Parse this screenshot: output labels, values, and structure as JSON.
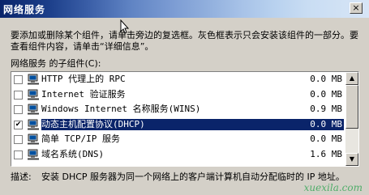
{
  "window": {
    "title": "网络服务",
    "close_glyph": "×"
  },
  "description": "要添加或删除某个组件，请单击旁边的复选框。灰色框表示只会安装该组件的一部分。要查看组件内容，请单击“详细信息”。",
  "subcomponents_label": "网络服务 的子组件(C):",
  "components": [
    {
      "name": "HTTP 代理上的 RPC",
      "size": "0.0 MB",
      "checked": false,
      "selected": false,
      "icon": "network-computer-icon"
    },
    {
      "name": "Internet 验证服务",
      "size": "0.0 MB",
      "checked": false,
      "selected": false,
      "icon": "network-computer-icon"
    },
    {
      "name": "Windows Internet 名称服务(WINS)",
      "size": "0.9 MB",
      "checked": false,
      "selected": false,
      "icon": "network-computer-icon"
    },
    {
      "name": "动态主机配置协议(DHCP)",
      "size": "0.0 MB",
      "checked": true,
      "selected": true,
      "icon": "network-computer-icon"
    },
    {
      "name": "简单 TCP/IP 服务",
      "size": "0.0 MB",
      "checked": false,
      "selected": false,
      "icon": "network-computer-icon"
    },
    {
      "name": "域名系统(DNS)",
      "size": "1.6 MB",
      "checked": false,
      "selected": false,
      "icon": "network-computer-icon"
    }
  ],
  "footer": {
    "label": "描述:",
    "text": "安装 DHCP 服务器为同一个网络上的客户端计算机自动分配临时的 IP 地址。"
  },
  "watermark": "xuexila.com",
  "colors": {
    "selection": "#0a246a",
    "dialog_bg": "#d4d0c8"
  }
}
